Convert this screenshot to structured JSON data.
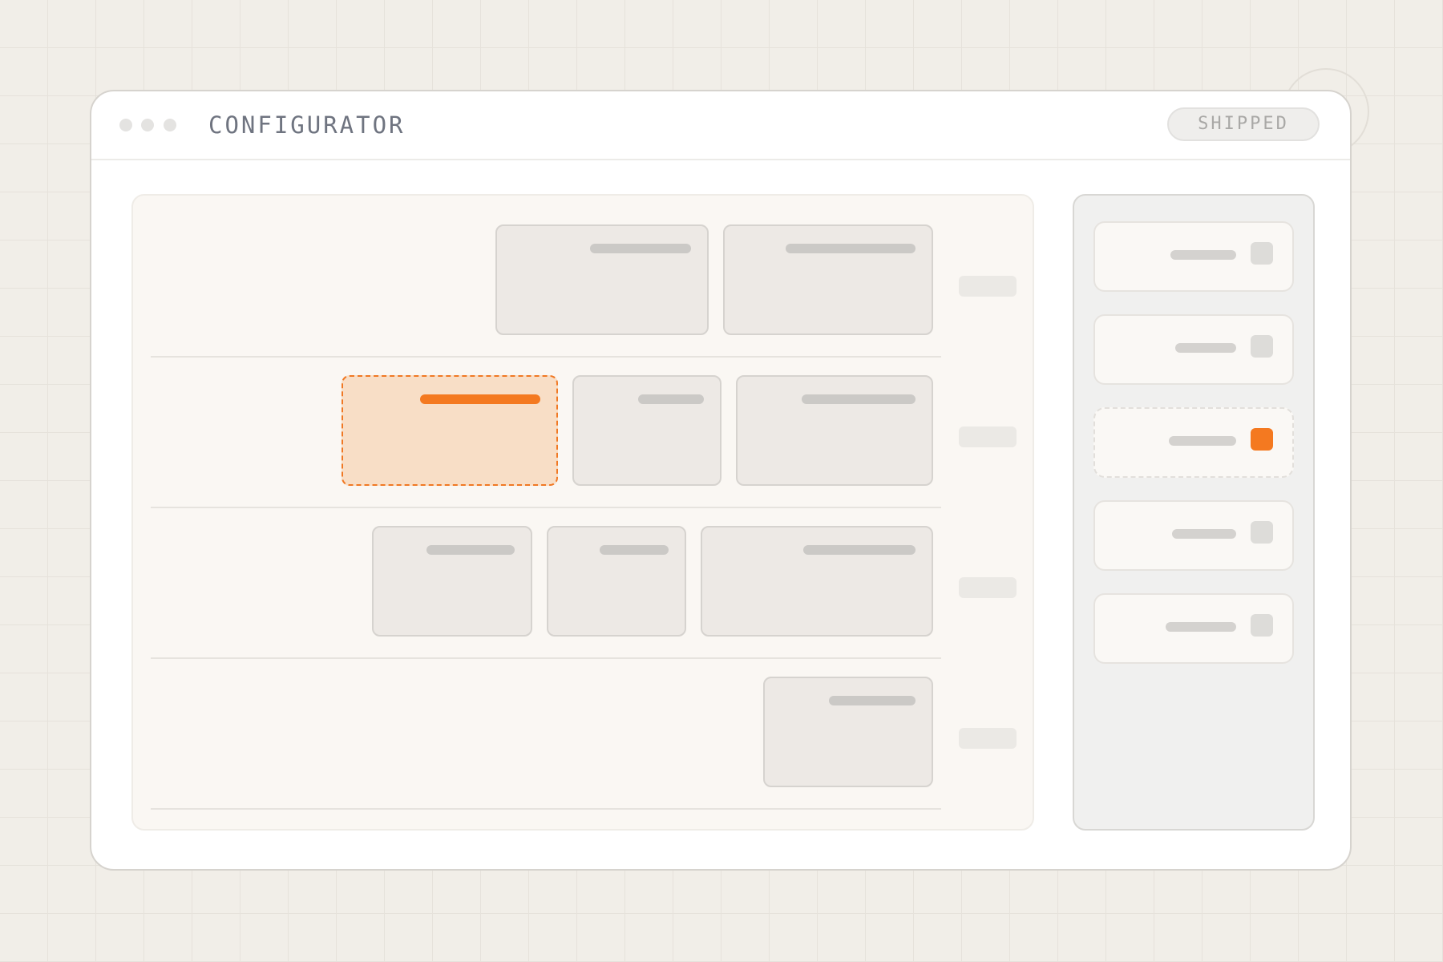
{
  "window": {
    "title": "CONFIGURATOR",
    "status_badge": "SHIPPED"
  },
  "board": {
    "lanes": [
      {
        "cards": [
          {
            "state": "default"
          },
          {
            "state": "default"
          }
        ]
      },
      {
        "cards": [
          {
            "state": "selected"
          },
          {
            "state": "default"
          },
          {
            "state": "default"
          }
        ]
      },
      {
        "cards": [
          {
            "state": "default"
          },
          {
            "state": "default"
          },
          {
            "state": "default"
          }
        ]
      },
      {
        "cards": [
          {
            "state": "default"
          }
        ]
      }
    ]
  },
  "sidebar": {
    "items": [
      {
        "checked": false
      },
      {
        "checked": false
      },
      {
        "checked": true,
        "highlighted": true
      },
      {
        "checked": false
      },
      {
        "checked": false
      }
    ]
  },
  "colors": {
    "accent": "#f47920",
    "selected_card_fill": "#f8dec6",
    "card_fill": "#ede9e5",
    "page_background": "#f1eee8"
  }
}
